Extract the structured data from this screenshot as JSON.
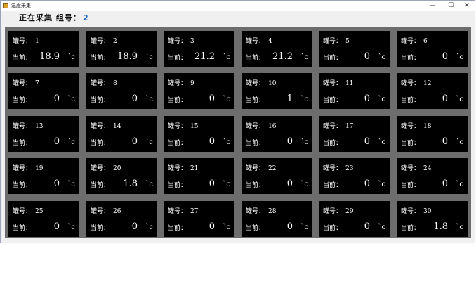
{
  "window": {
    "title": "温度采集",
    "minimize": "—",
    "maximize": "☐",
    "close": "✕"
  },
  "status": {
    "text": "正在采集 组号：",
    "group": "2"
  },
  "tile_labels": {
    "number_label": "罐号：",
    "current_label": "当前：",
    "unit": "`c"
  },
  "tiles": [
    {
      "num": "1",
      "val": "18.9"
    },
    {
      "num": "2",
      "val": "18.9"
    },
    {
      "num": "3",
      "val": "21.2"
    },
    {
      "num": "4",
      "val": "21.2"
    },
    {
      "num": "5",
      "val": "0"
    },
    {
      "num": "6",
      "val": "0"
    },
    {
      "num": "7",
      "val": "0"
    },
    {
      "num": "8",
      "val": "0"
    },
    {
      "num": "9",
      "val": "0"
    },
    {
      "num": "10",
      "val": "1"
    },
    {
      "num": "11",
      "val": "0"
    },
    {
      "num": "12",
      "val": "0"
    },
    {
      "num": "13",
      "val": "0"
    },
    {
      "num": "14",
      "val": "0"
    },
    {
      "num": "15",
      "val": "0"
    },
    {
      "num": "16",
      "val": "0"
    },
    {
      "num": "17",
      "val": "0"
    },
    {
      "num": "18",
      "val": "0"
    },
    {
      "num": "19",
      "val": "0"
    },
    {
      "num": "20",
      "val": "1.8"
    },
    {
      "num": "21",
      "val": "0"
    },
    {
      "num": "22",
      "val": "0"
    },
    {
      "num": "23",
      "val": "0"
    },
    {
      "num": "24",
      "val": "0"
    },
    {
      "num": "25",
      "val": "0"
    },
    {
      "num": "26",
      "val": "0"
    },
    {
      "num": "27",
      "val": "0"
    },
    {
      "num": "28",
      "val": "0"
    },
    {
      "num": "29",
      "val": "0"
    },
    {
      "num": "30",
      "val": "1.8"
    }
  ]
}
